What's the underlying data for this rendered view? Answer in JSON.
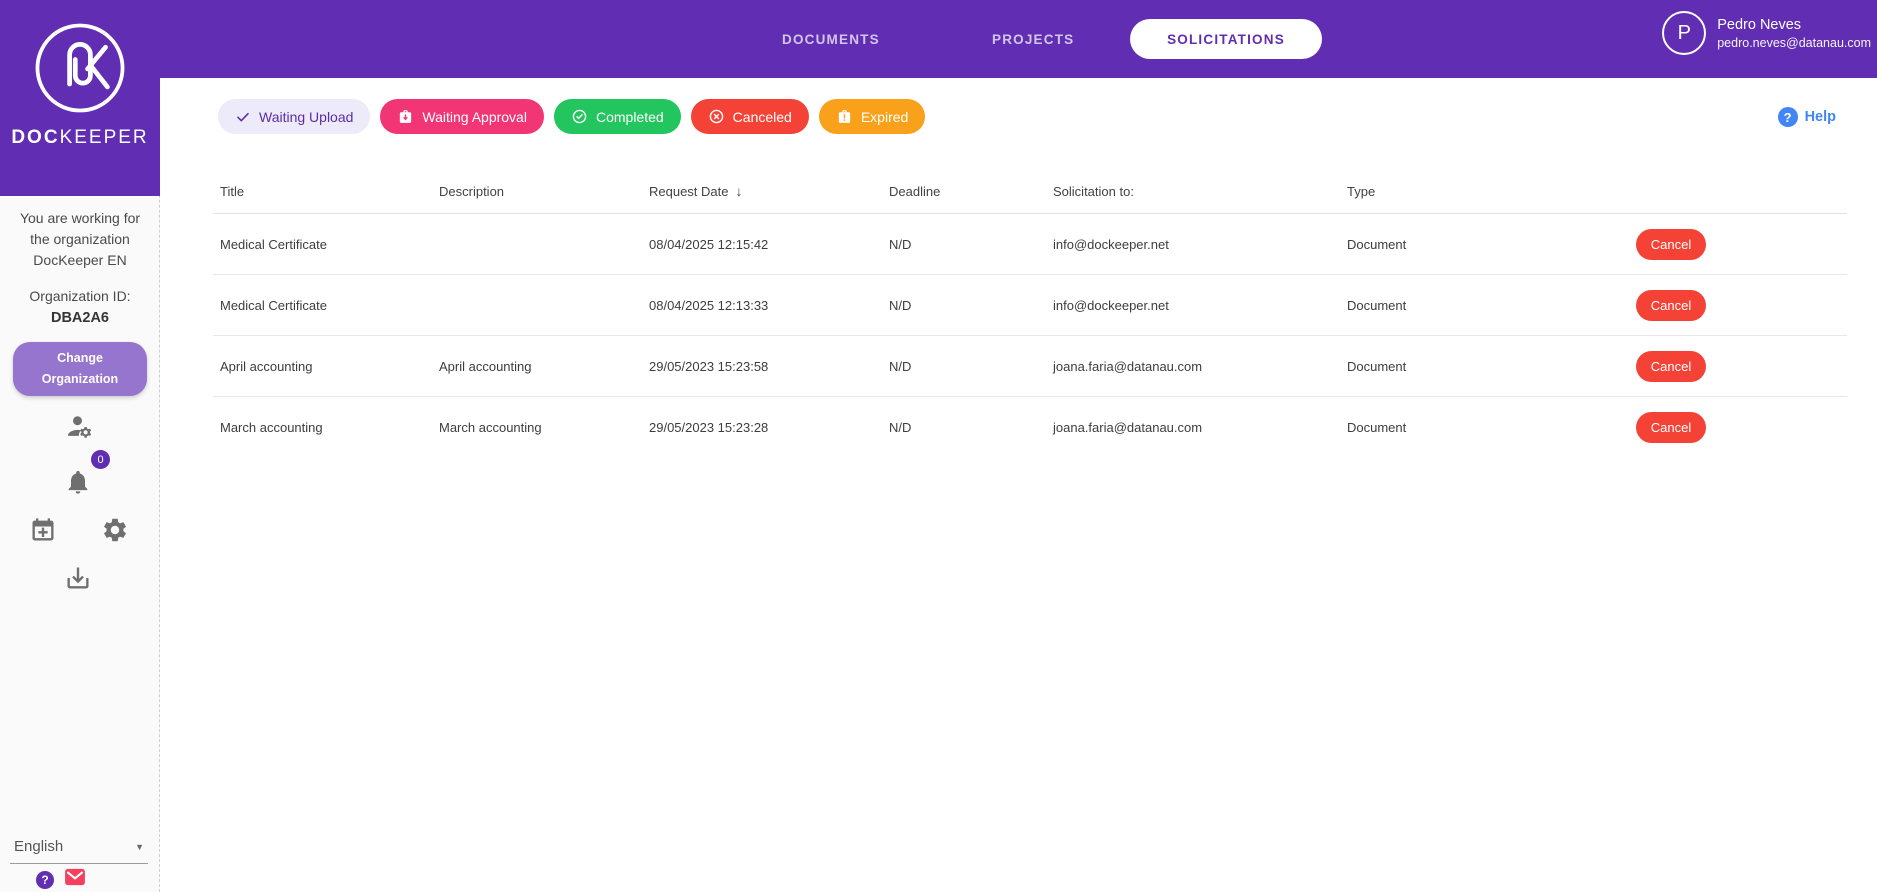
{
  "colors": {
    "brand_purple": "#612db2",
    "cancel_red": "#f44336",
    "help_blue": "#4285f4",
    "change_org_purple": "#9575cd"
  },
  "brand": {
    "name_bold": "DOC",
    "name_light": "KEEPER"
  },
  "nav": {
    "tabs": [
      {
        "label": "DOCUMENTS",
        "active": false
      },
      {
        "label": "PROJECTS",
        "active": false
      },
      {
        "label": "SOLICITATIONS",
        "active": true
      }
    ]
  },
  "user": {
    "initial": "P",
    "name": "Pedro Neves",
    "email": "pedro.neves@datanau.com"
  },
  "sidebar": {
    "working_for": [
      "You are working for",
      "the organization",
      "DocKeeper EN"
    ],
    "org_id_label": "Organization ID:",
    "org_id_value": "DBA2A6",
    "change_org_line1": "Change",
    "change_org_line2": "Organization",
    "notification_count": "0",
    "language": "English"
  },
  "filters": [
    {
      "label": "Waiting Upload",
      "bg": "#edeaf9",
      "fg": "#5b2daa"
    },
    {
      "label": "Waiting Approval",
      "bg": "#f23574",
      "fg": "#ffffff"
    },
    {
      "label": "Completed",
      "bg": "#22c55e",
      "fg": "#ffffff"
    },
    {
      "label": "Canceled",
      "bg": "#f44336",
      "fg": "#ffffff"
    },
    {
      "label": "Expired",
      "bg": "#f9a11b",
      "fg": "#ffffff"
    }
  ],
  "help_label": "Help",
  "table": {
    "columns": [
      "Title",
      "Description",
      "Request Date",
      "Deadline",
      "Solicitation to:",
      "Type"
    ],
    "sort": {
      "column": "Request Date",
      "direction": "desc",
      "glyph": "↓"
    },
    "rows": [
      {
        "title": "Medical Certificate",
        "description": "",
        "request_date": "08/04/2025 12:15:42",
        "deadline": "N/D",
        "solicitation_to": "info@dockeeper.net",
        "type": "Document",
        "action": "Cancel"
      },
      {
        "title": "Medical Certificate",
        "description": "",
        "request_date": "08/04/2025 12:13:33",
        "deadline": "N/D",
        "solicitation_to": "info@dockeeper.net",
        "type": "Document",
        "action": "Cancel"
      },
      {
        "title": "April accounting",
        "description": "April accounting",
        "request_date": "29/05/2023 15:23:58",
        "deadline": "N/D",
        "solicitation_to": "joana.faria@datanau.com",
        "type": "Document",
        "action": "Cancel"
      },
      {
        "title": "March accounting",
        "description": "March accounting",
        "request_date": "29/05/2023 15:23:28",
        "deadline": "N/D",
        "solicitation_to": "joana.faria@datanau.com",
        "type": "Document",
        "action": "Cancel"
      }
    ]
  }
}
